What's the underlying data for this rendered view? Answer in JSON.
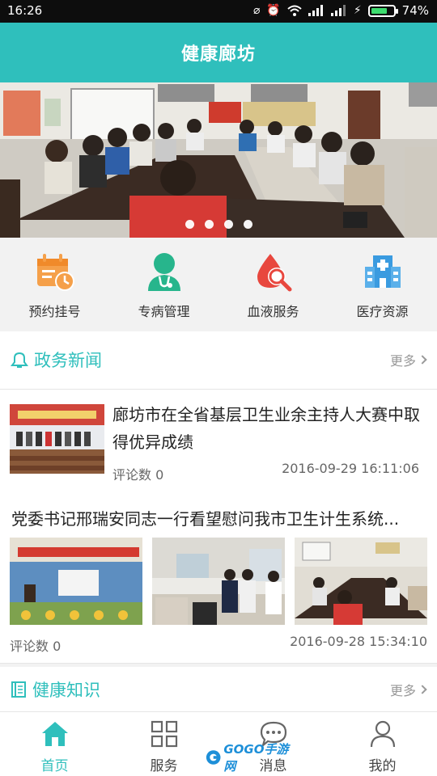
{
  "status_bar": {
    "time": "16:26",
    "battery": "74%",
    "battery_level": 0.74
  },
  "header": {
    "title": "健康廊坊"
  },
  "banner": {
    "slide_count": 4
  },
  "quick_nav": [
    {
      "label": "预约挂号",
      "icon": "calendar-clock-icon",
      "color": "#f5a04a"
    },
    {
      "label": "专病管理",
      "icon": "doctor-icon",
      "color": "#27b58c"
    },
    {
      "label": "血液服务",
      "icon": "blood-drop-search-icon",
      "color": "#e8473e"
    },
    {
      "label": "医疗资源",
      "icon": "hospital-icon",
      "color": "#3a9be0"
    }
  ],
  "sections": {
    "news": {
      "title": "政务新闻",
      "more": "更多"
    },
    "health": {
      "title": "健康知识",
      "more": "更多"
    }
  },
  "news": [
    {
      "title": "廊坊市在全省基层卫生业余主持人大赛中取得优异成绩",
      "comments": "评论数 0",
      "time": "2016-09-29 16:11:06"
    },
    {
      "title": "党委书记邢瑞安同志一行看望慰问我市卫生计生系统...",
      "comments": "评论数 0",
      "time": "2016-09-28 15:34:10"
    }
  ],
  "bottom_nav": [
    {
      "label": "首页",
      "icon": "home-icon",
      "active": true
    },
    {
      "label": "服务",
      "icon": "grid-icon",
      "active": false
    },
    {
      "label": "消息",
      "icon": "message-icon",
      "active": false
    },
    {
      "label": "我的",
      "icon": "user-icon",
      "active": false
    }
  ],
  "watermark": "GOGO手游网",
  "colors": {
    "accent": "#2fbfbc",
    "header": "#2fbfbc",
    "background_gray": "#f2f2f2"
  }
}
